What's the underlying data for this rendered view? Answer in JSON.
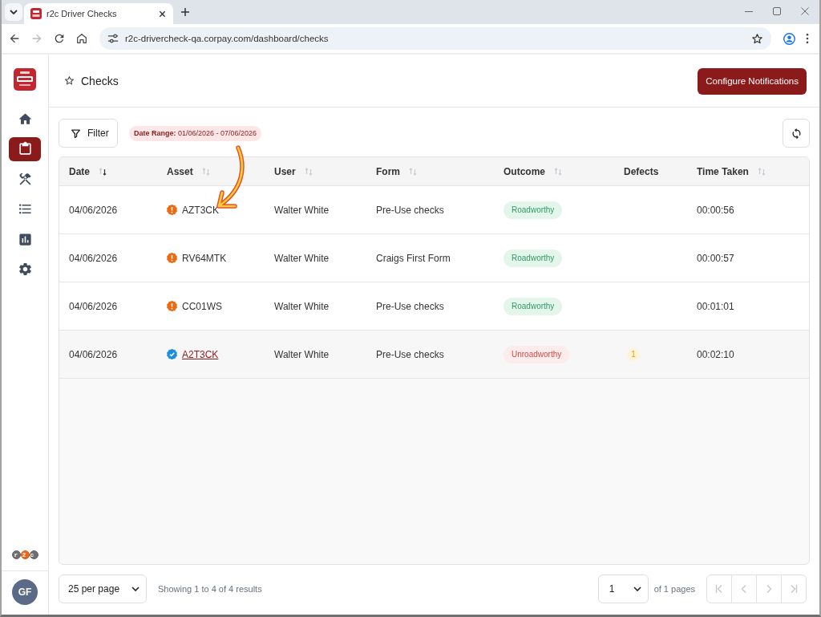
{
  "browser": {
    "tab": {
      "title": "r2c Driver Checks",
      "selected": true
    },
    "url": "r2c-drivercheck-qa.corpay.com/dashboard/checks"
  },
  "sidebar": {
    "items": [
      {
        "kind": "home",
        "selected": false
      },
      {
        "kind": "clipboard",
        "selected": true
      },
      {
        "kind": "tools",
        "selected": false
      },
      {
        "kind": "list",
        "selected": false
      },
      {
        "kind": "chart",
        "selected": false
      },
      {
        "kind": "settings",
        "selected": false
      }
    ],
    "brand": "r2c",
    "avatar": "GF"
  },
  "header": {
    "title": "Checks",
    "favorite": false,
    "action": "Configure Notifications"
  },
  "toolbar": {
    "filter": "Filter",
    "chips": [
      "**Date Range:** 01/06/2026 - 07/06/2026"
    ]
  },
  "table": {
    "columns": [
      {
        "label": "Date",
        "sortable": true,
        "sorted_descending": true
      },
      {
        "label": "Asset",
        "sortable": true,
        "sorted_descending": false
      },
      {
        "label": "User",
        "sortable": true,
        "sorted_descending": false
      },
      {
        "label": "Form",
        "sortable": true,
        "sorted_descending": false
      },
      {
        "label": "Outcome",
        "sortable": true,
        "sorted_descending": false
      },
      {
        "label": "Defects",
        "sortable": false
      },
      {
        "label": "Time Taken",
        "sortable": true,
        "sorted_descending": false
      }
    ],
    "rows": [
      {
        "date": "04/06/2026",
        "asset": {
          "label": "AZT3CK",
          "kind": "warning"
        },
        "user": "Walter White",
        "form": "Pre-Use checks",
        "outcome": {
          "label": "Roadworthy",
          "kind": "pass"
        },
        "time_taken": "00:00:56",
        "hovered": false
      },
      {
        "date": "04/06/2026",
        "asset": {
          "label": "RV64MTK",
          "kind": "warning"
        },
        "user": "Walter White",
        "form": "Craigs First Form",
        "outcome": {
          "label": "Roadworthy",
          "kind": "pass"
        },
        "time_taken": "00:00:57",
        "hovered": false
      },
      {
        "date": "04/06/2026",
        "asset": {
          "label": "CC01WS",
          "kind": "warning"
        },
        "user": "Walter White",
        "form": "Pre-Use checks",
        "outcome": {
          "label": "Roadworthy",
          "kind": "pass"
        },
        "time_taken": "00:01:01",
        "hovered": false
      },
      {
        "date": "04/06/2026",
        "asset": {
          "label": "A2T3CK",
          "kind": "verified"
        },
        "user": "Walter White",
        "form": "Pre-Use checks",
        "outcome": {
          "label": "Unroadworthy",
          "kind": "fail"
        },
        "defects": "1",
        "time_taken": "00:02:10",
        "hovered": true
      }
    ]
  },
  "annotation": {
    "kind": "arrow"
  },
  "footer": {
    "per_page": "25 per page",
    "summary": "Showing 1 to 4 of 4 results",
    "page": "1",
    "page_total": "of 1 pages",
    "pager": [
      {
        "kind": "first",
        "disabled": true
      },
      {
        "kind": "prev",
        "disabled": true
      },
      {
        "kind": "next",
        "disabled": true
      },
      {
        "kind": "last",
        "disabled": true
      }
    ]
  }
}
